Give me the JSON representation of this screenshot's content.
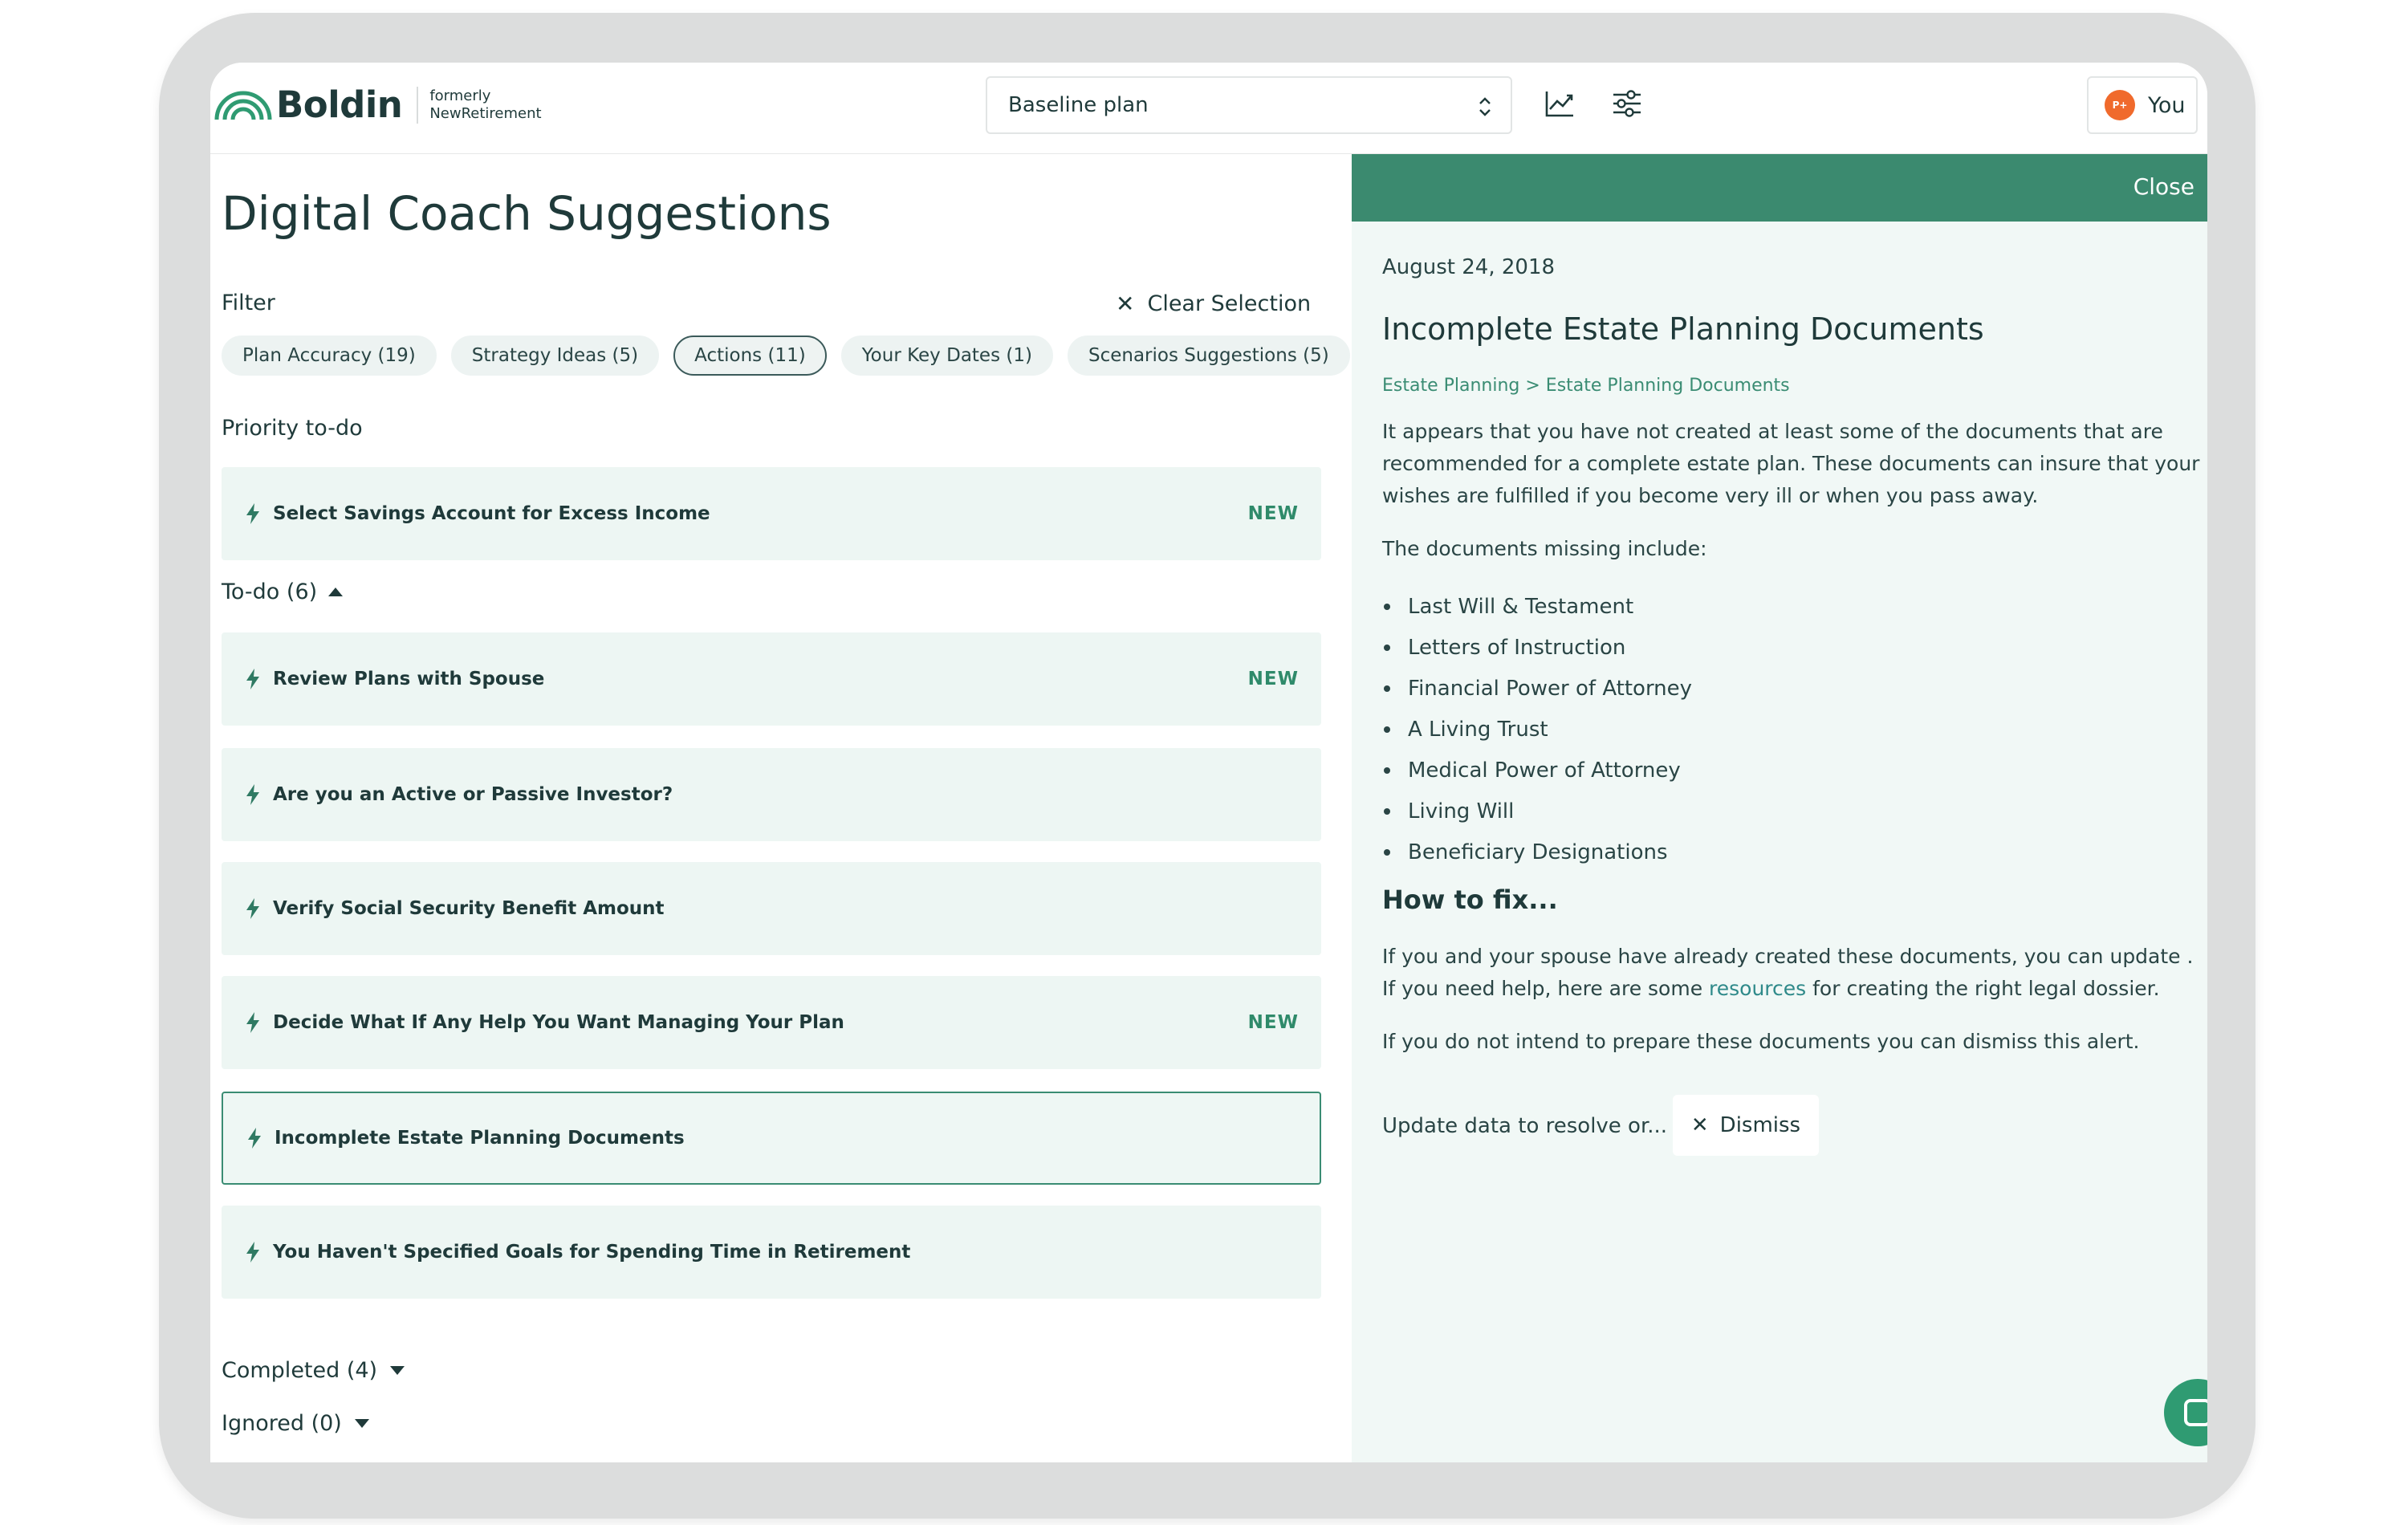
{
  "header": {
    "logo_text": "Boldin",
    "formerly_line1": "formerly",
    "formerly_line2": "NewRetirement",
    "plan_select_value": "Baseline plan",
    "user_label": "You",
    "avatar_initials": "P+",
    "icons": [
      "chart-line-icon",
      "sliders-icon",
      "chevron-updown-icon"
    ]
  },
  "left": {
    "title": "Digital Coach Suggestions",
    "filter_label": "Filter",
    "clear_selection": "Clear Selection",
    "chips": [
      {
        "label": "Plan Accuracy (19)",
        "active": false
      },
      {
        "label": "Strategy Ideas (5)",
        "active": false
      },
      {
        "label": "Actions (11)",
        "active": true
      },
      {
        "label": "Your Key Dates (1)",
        "active": false
      },
      {
        "label": "Scenarios Suggestions (5)",
        "active": false
      }
    ],
    "priority_label": "Priority to-do",
    "priority_items": [
      {
        "title": "Select Savings Account for Excess Income",
        "badge": "NEW"
      }
    ],
    "todo_label": "To-do (6)",
    "todo_items": [
      {
        "title": "Review Plans with Spouse",
        "badge": "NEW"
      },
      {
        "title": "Are you an Active or Passive Investor?",
        "badge": ""
      },
      {
        "title": "Verify Social Security Benefit Amount",
        "badge": ""
      },
      {
        "title": "Decide What If Any Help You Want Managing Your Plan",
        "badge": "NEW"
      },
      {
        "title": "Incomplete Estate Planning Documents",
        "badge": "",
        "selected": true
      },
      {
        "title": "You Haven't Specified Goals for Spending Time in Retirement",
        "badge": ""
      }
    ],
    "completed_label": "Completed (4)",
    "ignored_label": "Ignored (0)"
  },
  "detail": {
    "close_label": "Close",
    "date": "August 24, 2018",
    "title": "Incomplete Estate Planning Documents",
    "breadcrumb": "Estate Planning > Estate Planning Documents",
    "intro": "It appears that you have not created at least some of the documents that are recommended for a complete estate plan. These documents can insure that your wishes are fulfilled if you become very ill or when you pass away.",
    "missing_intro": "The documents missing include:",
    "missing_docs": [
      "Last Will & Testament",
      "Letters of Instruction",
      "Financial Power of Attorney",
      "A Living Trust",
      "Medical Power of Attorney",
      "Living Will",
      "Beneficiary Designations"
    ],
    "howto_title": "How to fix...",
    "fix_part1": "If you and your spouse have already created these documents, you can update . If you need help, here are some ",
    "fix_link": "resources",
    "fix_part2": " for creating the right legal dossier.",
    "dismiss_note": "If you do not intend to prepare these documents you can dismiss this alert.",
    "resolve_label": "Update data to resolve or...",
    "dismiss_label": "Dismiss"
  },
  "colors": {
    "brand_green": "#3b8a6f",
    "card_bg": "#edf6f3",
    "badge_green": "#2f8a6a",
    "text_dark": "#1f3a3a",
    "avatar_orange": "#f06a2c"
  }
}
